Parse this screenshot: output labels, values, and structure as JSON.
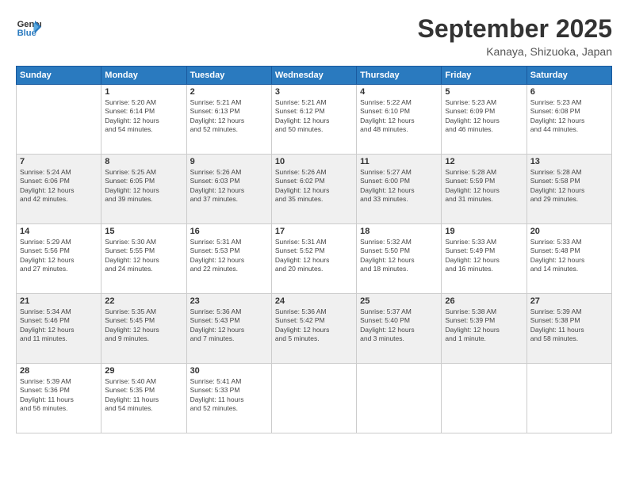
{
  "logo": {
    "line1": "General",
    "line2": "Blue",
    "icon": "▶"
  },
  "title": "September 2025",
  "location": "Kanaya, Shizuoka, Japan",
  "weekdays": [
    "Sunday",
    "Monday",
    "Tuesday",
    "Wednesday",
    "Thursday",
    "Friday",
    "Saturday"
  ],
  "weeks": [
    [
      {
        "day": "",
        "info": ""
      },
      {
        "day": "1",
        "info": "Sunrise: 5:20 AM\nSunset: 6:14 PM\nDaylight: 12 hours\nand 54 minutes."
      },
      {
        "day": "2",
        "info": "Sunrise: 5:21 AM\nSunset: 6:13 PM\nDaylight: 12 hours\nand 52 minutes."
      },
      {
        "day": "3",
        "info": "Sunrise: 5:21 AM\nSunset: 6:12 PM\nDaylight: 12 hours\nand 50 minutes."
      },
      {
        "day": "4",
        "info": "Sunrise: 5:22 AM\nSunset: 6:10 PM\nDaylight: 12 hours\nand 48 minutes."
      },
      {
        "day": "5",
        "info": "Sunrise: 5:23 AM\nSunset: 6:09 PM\nDaylight: 12 hours\nand 46 minutes."
      },
      {
        "day": "6",
        "info": "Sunrise: 5:23 AM\nSunset: 6:08 PM\nDaylight: 12 hours\nand 44 minutes."
      }
    ],
    [
      {
        "day": "7",
        "info": "Sunrise: 5:24 AM\nSunset: 6:06 PM\nDaylight: 12 hours\nand 42 minutes."
      },
      {
        "day": "8",
        "info": "Sunrise: 5:25 AM\nSunset: 6:05 PM\nDaylight: 12 hours\nand 39 minutes."
      },
      {
        "day": "9",
        "info": "Sunrise: 5:26 AM\nSunset: 6:03 PM\nDaylight: 12 hours\nand 37 minutes."
      },
      {
        "day": "10",
        "info": "Sunrise: 5:26 AM\nSunset: 6:02 PM\nDaylight: 12 hours\nand 35 minutes."
      },
      {
        "day": "11",
        "info": "Sunrise: 5:27 AM\nSunset: 6:00 PM\nDaylight: 12 hours\nand 33 minutes."
      },
      {
        "day": "12",
        "info": "Sunrise: 5:28 AM\nSunset: 5:59 PM\nDaylight: 12 hours\nand 31 minutes."
      },
      {
        "day": "13",
        "info": "Sunrise: 5:28 AM\nSunset: 5:58 PM\nDaylight: 12 hours\nand 29 minutes."
      }
    ],
    [
      {
        "day": "14",
        "info": "Sunrise: 5:29 AM\nSunset: 5:56 PM\nDaylight: 12 hours\nand 27 minutes."
      },
      {
        "day": "15",
        "info": "Sunrise: 5:30 AM\nSunset: 5:55 PM\nDaylight: 12 hours\nand 24 minutes."
      },
      {
        "day": "16",
        "info": "Sunrise: 5:31 AM\nSunset: 5:53 PM\nDaylight: 12 hours\nand 22 minutes."
      },
      {
        "day": "17",
        "info": "Sunrise: 5:31 AM\nSunset: 5:52 PM\nDaylight: 12 hours\nand 20 minutes."
      },
      {
        "day": "18",
        "info": "Sunrise: 5:32 AM\nSunset: 5:50 PM\nDaylight: 12 hours\nand 18 minutes."
      },
      {
        "day": "19",
        "info": "Sunrise: 5:33 AM\nSunset: 5:49 PM\nDaylight: 12 hours\nand 16 minutes."
      },
      {
        "day": "20",
        "info": "Sunrise: 5:33 AM\nSunset: 5:48 PM\nDaylight: 12 hours\nand 14 minutes."
      }
    ],
    [
      {
        "day": "21",
        "info": "Sunrise: 5:34 AM\nSunset: 5:46 PM\nDaylight: 12 hours\nand 11 minutes."
      },
      {
        "day": "22",
        "info": "Sunrise: 5:35 AM\nSunset: 5:45 PM\nDaylight: 12 hours\nand 9 minutes."
      },
      {
        "day": "23",
        "info": "Sunrise: 5:36 AM\nSunset: 5:43 PM\nDaylight: 12 hours\nand 7 minutes."
      },
      {
        "day": "24",
        "info": "Sunrise: 5:36 AM\nSunset: 5:42 PM\nDaylight: 12 hours\nand 5 minutes."
      },
      {
        "day": "25",
        "info": "Sunrise: 5:37 AM\nSunset: 5:40 PM\nDaylight: 12 hours\nand 3 minutes."
      },
      {
        "day": "26",
        "info": "Sunrise: 5:38 AM\nSunset: 5:39 PM\nDaylight: 12 hours\nand 1 minute."
      },
      {
        "day": "27",
        "info": "Sunrise: 5:39 AM\nSunset: 5:38 PM\nDaylight: 11 hours\nand 58 minutes."
      }
    ],
    [
      {
        "day": "28",
        "info": "Sunrise: 5:39 AM\nSunset: 5:36 PM\nDaylight: 11 hours\nand 56 minutes."
      },
      {
        "day": "29",
        "info": "Sunrise: 5:40 AM\nSunset: 5:35 PM\nDaylight: 11 hours\nand 54 minutes."
      },
      {
        "day": "30",
        "info": "Sunrise: 5:41 AM\nSunset: 5:33 PM\nDaylight: 11 hours\nand 52 minutes."
      },
      {
        "day": "",
        "info": ""
      },
      {
        "day": "",
        "info": ""
      },
      {
        "day": "",
        "info": ""
      },
      {
        "day": "",
        "info": ""
      }
    ]
  ]
}
